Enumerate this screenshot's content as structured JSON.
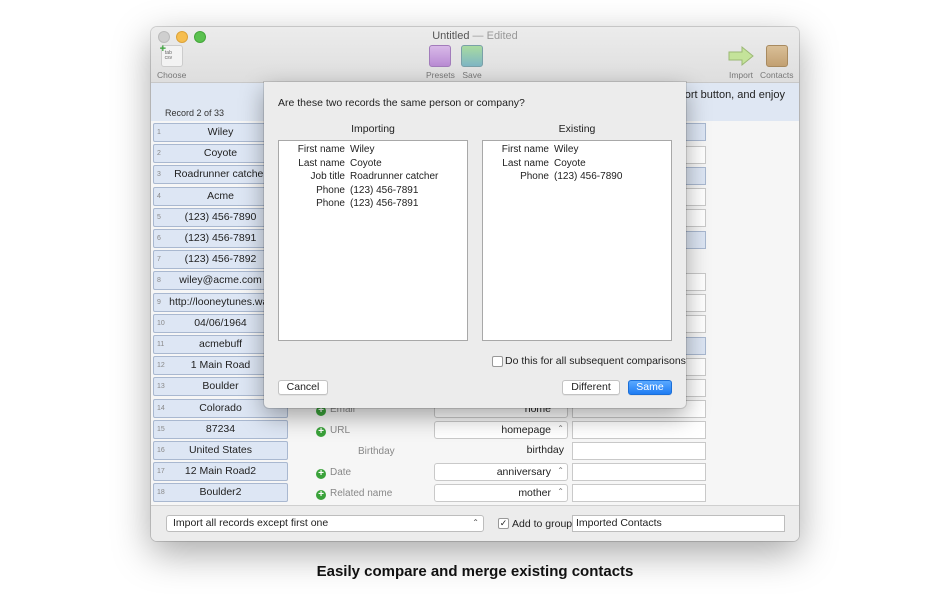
{
  "window": {
    "title": "Untitled",
    "title_suffix": "— Edited"
  },
  "toolbar": {
    "choose": "Choose",
    "choose_file_text": "tab\ncsv",
    "presets": "Presets",
    "save": "Save",
    "import": "Import",
    "contacts": "Contacts"
  },
  "banner": {
    "text": "nport button, and enjoy"
  },
  "records": {
    "label": "Record 2 of 33",
    "rows": [
      {
        "n": "1",
        "value": "Wiley"
      },
      {
        "n": "2",
        "value": "Coyote"
      },
      {
        "n": "3",
        "value": "Roadrunner catcher"
      },
      {
        "n": "4",
        "value": "Acme"
      },
      {
        "n": "5",
        "value": "(123) 456-7890"
      },
      {
        "n": "6",
        "value": "(123) 456-7891"
      },
      {
        "n": "7",
        "value": "(123) 456-7892"
      },
      {
        "n": "8",
        "value": "wiley@acme.com"
      },
      {
        "n": "9",
        "value": "http://looneytunes.war"
      },
      {
        "n": "10",
        "value": "04/06/1964"
      },
      {
        "n": "11",
        "value": "acmebuff"
      },
      {
        "n": "12",
        "value": "1 Main Road"
      },
      {
        "n": "13",
        "value": "Boulder"
      },
      {
        "n": "14",
        "value": "Colorado"
      },
      {
        "n": "15",
        "value": "87234"
      },
      {
        "n": "16",
        "value": "United States"
      },
      {
        "n": "17",
        "value": "12 Main Road2"
      },
      {
        "n": "18",
        "value": "Boulder2"
      }
    ]
  },
  "mapping": [
    {
      "field": "Email",
      "type": "home"
    },
    {
      "field": "URL",
      "type": "homepage"
    },
    {
      "field": "Birthday",
      "type": "birthday"
    },
    {
      "field": "Date",
      "type": "anniversary"
    },
    {
      "field": "Related name",
      "type": "mother"
    }
  ],
  "bottom": {
    "import_option": "Import all records except first one",
    "add_to_group_label": "Add to group",
    "add_to_group_checked": "✓",
    "group_name": "Imported Contacts"
  },
  "dialog": {
    "question": "Are these two records the same person or company?",
    "importing_header": "Importing",
    "existing_header": "Existing",
    "importing": [
      {
        "k": "First name",
        "v": "Wiley"
      },
      {
        "k": "Last name",
        "v": "Coyote"
      },
      {
        "k": "Job title",
        "v": "Roadrunner catcher"
      },
      {
        "k": "Phone",
        "v": "(123) 456-7891"
      },
      {
        "k": "Phone",
        "v": "(123) 456-7891"
      }
    ],
    "existing": [
      {
        "k": "First name",
        "v": "Wiley"
      },
      {
        "k": "Last name",
        "v": "Coyote"
      },
      {
        "k": "Phone",
        "v": "(123) 456-7890"
      }
    ],
    "subsequent_label": "Do this for all subsequent comparisons",
    "cancel": "Cancel",
    "different": "Different",
    "same": "Same"
  },
  "caption": "Easily compare and merge existing contacts",
  "colors": {
    "accent": "#1f7cf3",
    "row_fill": "#dde6f4",
    "banner": "#dfe7f3",
    "plus": "#3aa23a"
  }
}
